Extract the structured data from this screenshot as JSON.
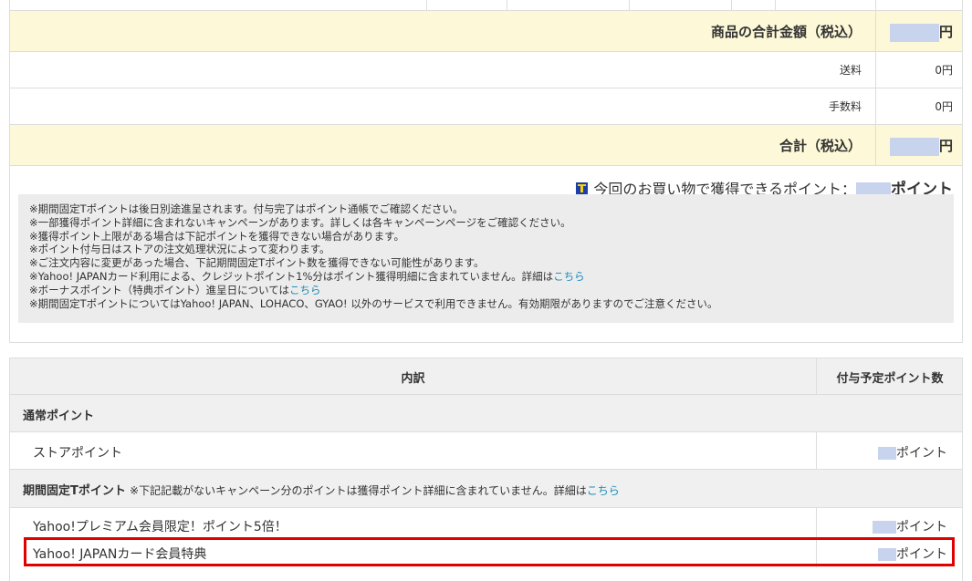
{
  "summary": {
    "subtotal_label": "商品の合計金額（税込）",
    "subtotal_unit": "円",
    "shipping_label": "送料",
    "shipping_value": "0円",
    "fee_label": "手数料",
    "fee_value": "0円",
    "total_label": "合計（税込）",
    "total_unit": "円"
  },
  "points_earned": {
    "icon": "t-point-icon",
    "label": "今回のお買い物で獲得できるポイント：",
    "unit": "ポイント"
  },
  "notes": {
    "line1": "※期間固定Tポイントは後日別途進呈されます。付与完了はポイント通帳でご確認ください。",
    "line2": "※一部獲得ポイント詳細に含まれないキャンペーンがあります。詳しくは各キャンペーンページをご確認ください。",
    "line3": "※獲得ポイント上限がある場合は下記ポイントを獲得できない場合があります。",
    "line4": "※ポイント付与日はストアの注文処理状況によって変わります。",
    "line5": "※ご注文内容に変更があった場合、下記期間固定Tポイント数を獲得できない可能性があります。",
    "line6": "※Yahoo! JAPANカード利用による、クレジットポイント1%分はポイント獲得明細に含まれていません。詳細は",
    "line6_link": "こちら",
    "line7": "※ボーナスポイント（特典ポイント）進呈日については",
    "line7_link": "こちら",
    "line8": "※期間固定TポイントについてはYahoo! JAPAN、LOHACO、GYAO! 以外のサービスで利用できません。有効期限がありますのでご注意ください。"
  },
  "breakdown": {
    "col_detail": "内訳",
    "col_points": "付与予定ポイント数",
    "section1_title": "通常ポイント",
    "store_points_label": "ストアポイント",
    "section2_title": "期間固定Tポイント",
    "section2_note": "※下記記載がないキャンペーン分のポイントは獲得ポイント詳細に含まれていません。詳細は",
    "section2_link": "こちら",
    "premium_label": "Yahoo!プレミアム会員限定！ポイント5倍！",
    "card_label": "Yahoo! JAPANカード会員特典",
    "points_unit": "ポイント"
  },
  "colors": {
    "highlight_border": "#e00000",
    "link": "#1a8cb7",
    "mask": "#c8d3ee",
    "summary_bg": "#fdf9d8"
  }
}
